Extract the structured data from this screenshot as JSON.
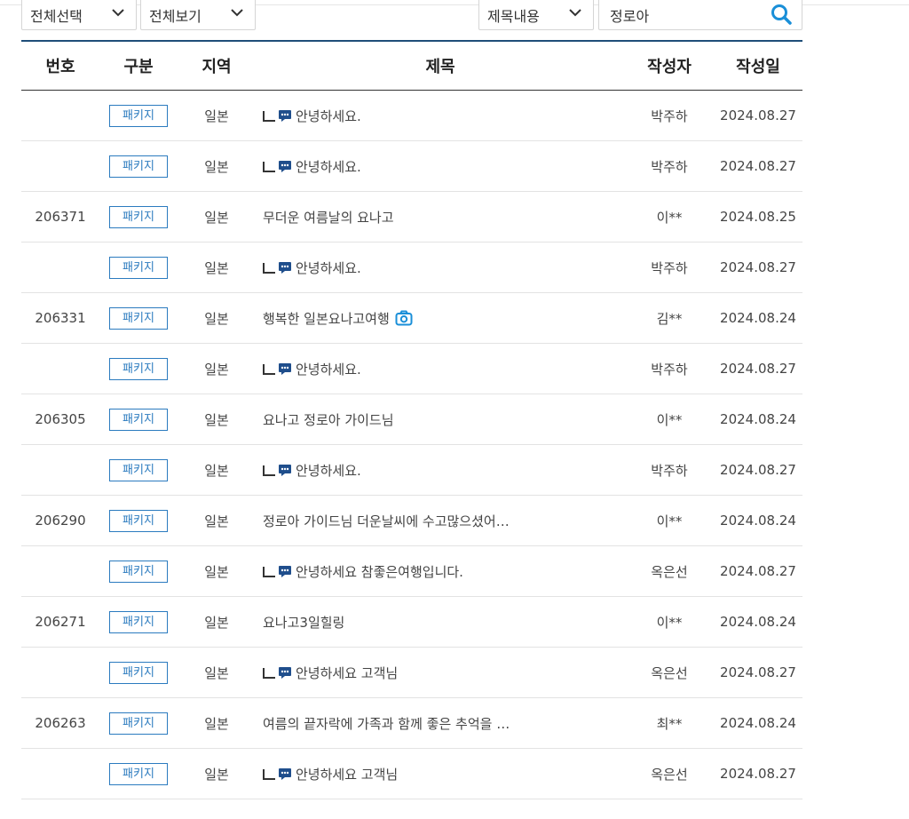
{
  "filters": {
    "select_all": "전체선택",
    "view_all": "전체보기",
    "search_field": "제목내용",
    "search_value": "정로아"
  },
  "table": {
    "headers": [
      "번호",
      "구분",
      "지역",
      "제목",
      "작성자",
      "작성일"
    ],
    "rows": [
      {
        "no": "",
        "category": "패키지",
        "region": "일본",
        "title": "안녕하세요.",
        "reply": true,
        "photo": false,
        "author": "박주하",
        "staff": true,
        "date": "2024.08.27"
      },
      {
        "no": "",
        "category": "패키지",
        "region": "일본",
        "title": "안녕하세요.",
        "reply": true,
        "photo": false,
        "author": "박주하",
        "staff": true,
        "date": "2024.08.27"
      },
      {
        "no": "206371",
        "category": "패키지",
        "region": "일본",
        "title": "무더운 여름날의 요나고",
        "reply": false,
        "photo": false,
        "author": "이**",
        "staff": false,
        "date": "2024.08.25"
      },
      {
        "no": "",
        "category": "패키지",
        "region": "일본",
        "title": "안녕하세요.",
        "reply": true,
        "photo": false,
        "author": "박주하",
        "staff": true,
        "date": "2024.08.27"
      },
      {
        "no": "206331",
        "category": "패키지",
        "region": "일본",
        "title": "행복한 일본요나고여행",
        "reply": false,
        "photo": true,
        "author": "김**",
        "staff": false,
        "date": "2024.08.24"
      },
      {
        "no": "",
        "category": "패키지",
        "region": "일본",
        "title": "안녕하세요.",
        "reply": true,
        "photo": false,
        "author": "박주하",
        "staff": true,
        "date": "2024.08.27"
      },
      {
        "no": "206305",
        "category": "패키지",
        "region": "일본",
        "title": "요나고 정로아 가이드님",
        "reply": false,
        "photo": false,
        "author": "이**",
        "staff": false,
        "date": "2024.08.24"
      },
      {
        "no": "",
        "category": "패키지",
        "region": "일본",
        "title": "안녕하세요.",
        "reply": true,
        "photo": false,
        "author": "박주하",
        "staff": true,
        "date": "2024.08.27"
      },
      {
        "no": "206290",
        "category": "패키지",
        "region": "일본",
        "title": "정로아 가이드님 더운날씨에 수고많으셨어…",
        "reply": false,
        "photo": false,
        "author": "이**",
        "staff": false,
        "date": "2024.08.24"
      },
      {
        "no": "",
        "category": "패키지",
        "region": "일본",
        "title": "안녕하세요 참좋은여행입니다.",
        "reply": true,
        "photo": false,
        "author": "옥은선",
        "staff": true,
        "date": "2024.08.27"
      },
      {
        "no": "206271",
        "category": "패키지",
        "region": "일본",
        "title": "요나고3일힐링",
        "reply": false,
        "photo": false,
        "author": "이**",
        "staff": false,
        "date": "2024.08.24"
      },
      {
        "no": "",
        "category": "패키지",
        "region": "일본",
        "title": "안녕하세요 고객님",
        "reply": true,
        "photo": false,
        "author": "옥은선",
        "staff": true,
        "date": "2024.08.27"
      },
      {
        "no": "206263",
        "category": "패키지",
        "region": "일본",
        "title": "여름의 끝자락에 가족과 함께 좋은 추억을 …",
        "reply": false,
        "photo": false,
        "author": "최**",
        "staff": false,
        "date": "2024.08.24"
      },
      {
        "no": "",
        "category": "패키지",
        "region": "일본",
        "title": "안녕하세요 고객님",
        "reply": true,
        "photo": false,
        "author": "옥은선",
        "staff": true,
        "date": "2024.08.27"
      }
    ]
  },
  "colors": {
    "accent": "#2b7bbf",
    "header_line": "#1f4e79",
    "search_icon": "#1a8fd8"
  }
}
